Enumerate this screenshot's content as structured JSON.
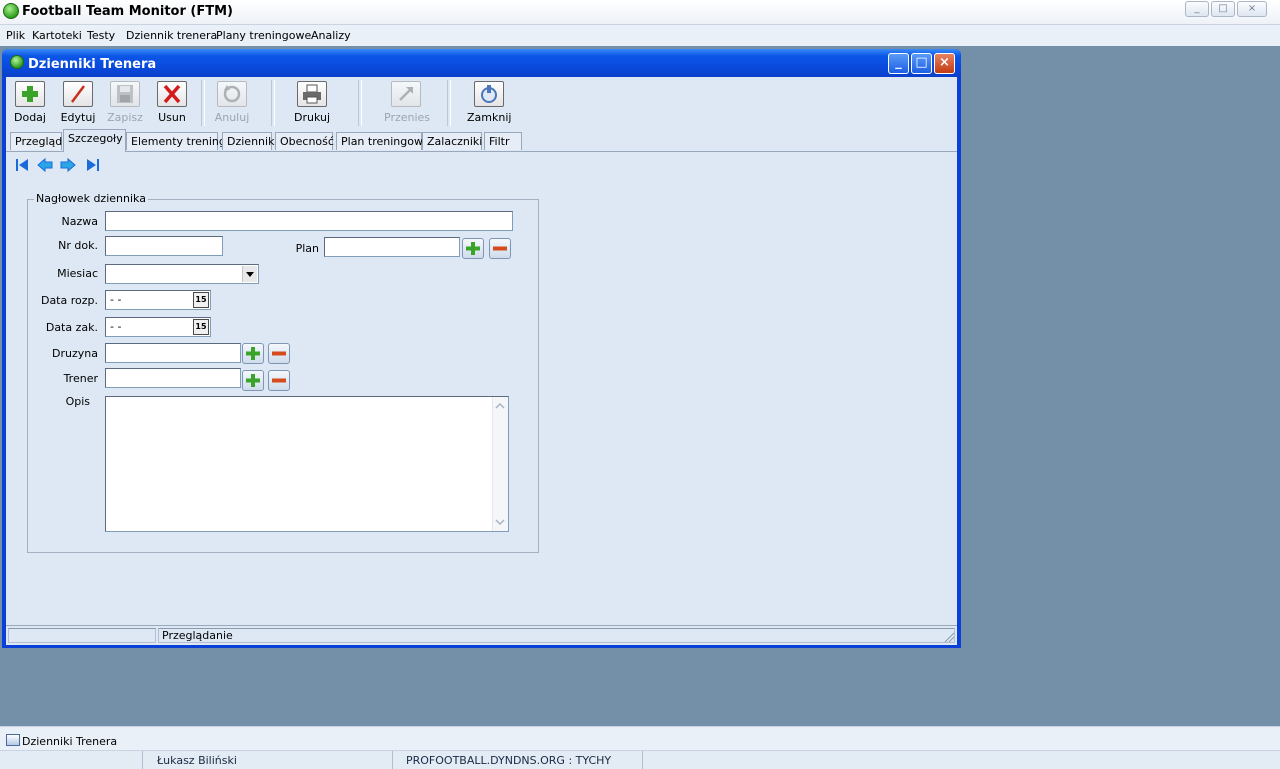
{
  "app": {
    "title": "Football Team Monitor (FTM)",
    "controls": [
      "_",
      "□",
      "×"
    ]
  },
  "menu": [
    "Plik",
    "Kartoteki",
    "Testy",
    "Dziennik trenera",
    "Plany treningowe",
    "Analizy"
  ],
  "window": {
    "title": "Dzienniki Trenera",
    "buttons": [
      "_",
      "□",
      "×"
    ]
  },
  "toolbar": {
    "dodaj": "Dodaj",
    "edytuj": "Edytuj",
    "zapisz": "Zapisz",
    "usun": "Usun",
    "anuluj": "Anuluj",
    "drukuj": "Drukuj",
    "przenies": "Przenies",
    "zamknij": "Zamknij"
  },
  "tabs": [
    "Przegląd",
    "Szczegoły",
    "Elementy treningu",
    "Dziennik",
    "Obecność",
    "Plan treningowy",
    "Zalaczniki",
    "Filtr"
  ],
  "active_tab": "Szczegoły",
  "form": {
    "group_title": "Nagłowek dziennika",
    "nazwa_label": "Nazwa",
    "nazwa_value": "",
    "nrdok_label": "Nr dok.",
    "nrdok_value": "",
    "plan_label": "Plan",
    "plan_value": "",
    "miesiac_label": "Miesiac",
    "miesiac_value": "",
    "data_rozp_label": "Data rozp.",
    "data_rozp_value": " -  -",
    "data_zak_label": "Data zak.",
    "data_zak_value": " -  -",
    "druzyna_label": "Druzyna",
    "druzyna_value": "",
    "trener_label": "Trener",
    "trener_value": "",
    "opis_label": "Opis",
    "calendar_glyph": "15"
  },
  "status": {
    "panel1": "",
    "panel2": "Przeglądanie"
  },
  "taskbar": {
    "item": "Dzienniki Trenera"
  },
  "bottom": {
    "user": "Łukasz Biliński",
    "server": "PROFOOTBALL.DYNDNS.ORG : TYCHY"
  },
  "colors": {
    "mdi_background": "#7490a8",
    "window_frame": "#0a40d8",
    "form_background": "#dde8f4",
    "plus": "#3aa32a",
    "minus": "#d64b1e"
  }
}
